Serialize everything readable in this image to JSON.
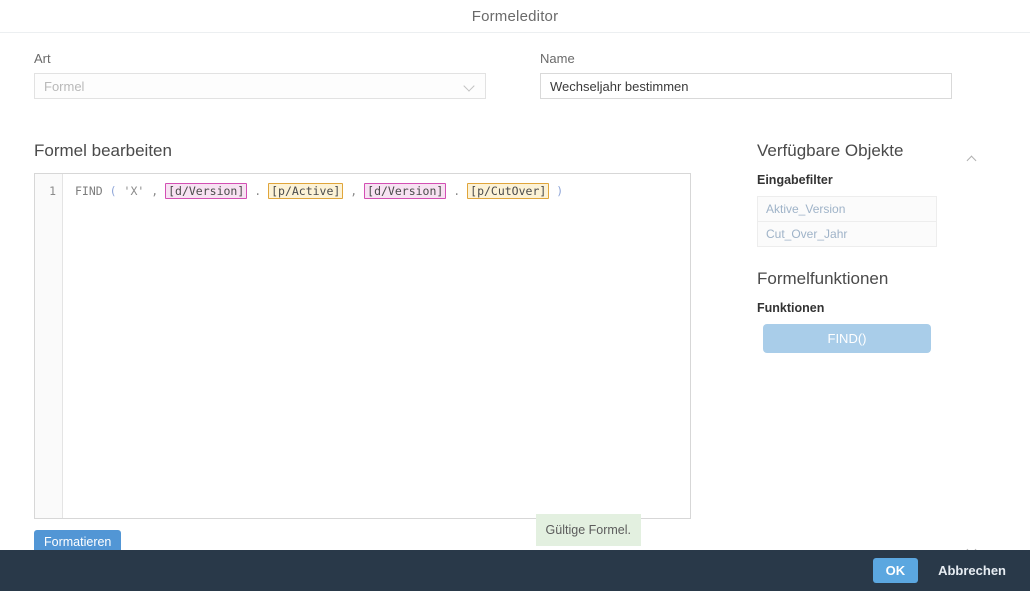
{
  "window": {
    "title": "Formeleditor"
  },
  "form": {
    "art": {
      "label": "Art",
      "value": "Formel",
      "placeholder": "Formel",
      "disabled": true,
      "chevron_icon": "chevron-down-icon"
    },
    "name": {
      "label": "Name",
      "value": "Wechseljahr bestimmen",
      "placeholder": "Name"
    }
  },
  "editor": {
    "heading": "Formel bearbeiten",
    "line_number": "1",
    "formula_text": "FIND ( 'X' , [d/Version] . [p/Active] , [d/Version] . [p/CutOver] )",
    "tokens": [
      {
        "text": "FIND",
        "kind": "fn"
      },
      {
        "text": "(",
        "kind": "paren"
      },
      {
        "text": "'X'",
        "kind": "str"
      },
      {
        "text": ",",
        "kind": "plain"
      },
      {
        "text": "[d/Version]",
        "kind": "dimension"
      },
      {
        "text": ".",
        "kind": "plain"
      },
      {
        "text": "[p/Active]",
        "kind": "property"
      },
      {
        "text": ",",
        "kind": "plain"
      },
      {
        "text": "[d/Version]",
        "kind": "dimension"
      },
      {
        "text": ".",
        "kind": "plain"
      },
      {
        "text": "[p/CutOver]",
        "kind": "property"
      },
      {
        "text": ")",
        "kind": "paren"
      }
    ],
    "format_button": "Formatieren",
    "validation_message": "Gültige Formel."
  },
  "right_panel": {
    "objects_heading": "Verfügbare Objekte",
    "objects_subheading": "Eingabefilter",
    "objects": [
      {
        "label": "Aktive_Version"
      },
      {
        "label": "Cut_Over_Jahr"
      }
    ],
    "functions_heading": "Formelfunktionen",
    "functions_subheading": "Funktionen",
    "functions": [
      {
        "label": "FIND()"
      }
    ],
    "scroll_up_icon": "chevron-up-icon",
    "scroll_down_icon": "chevron-down-icon"
  },
  "footer": {
    "ok_label": "OK",
    "cancel_label": "Abbrechen"
  },
  "colors": {
    "accent_blue": "#5296d5",
    "ok_blue": "#5ba7e0",
    "function_blue": "#a9cde9",
    "footer_dark": "#293949",
    "valid_green_bg": "#e3f0e0",
    "dimension_border": "#d34fb4",
    "dimension_bg": "#f7e2f2",
    "property_border": "#e0a53b",
    "property_bg": "#fcf2d6"
  }
}
